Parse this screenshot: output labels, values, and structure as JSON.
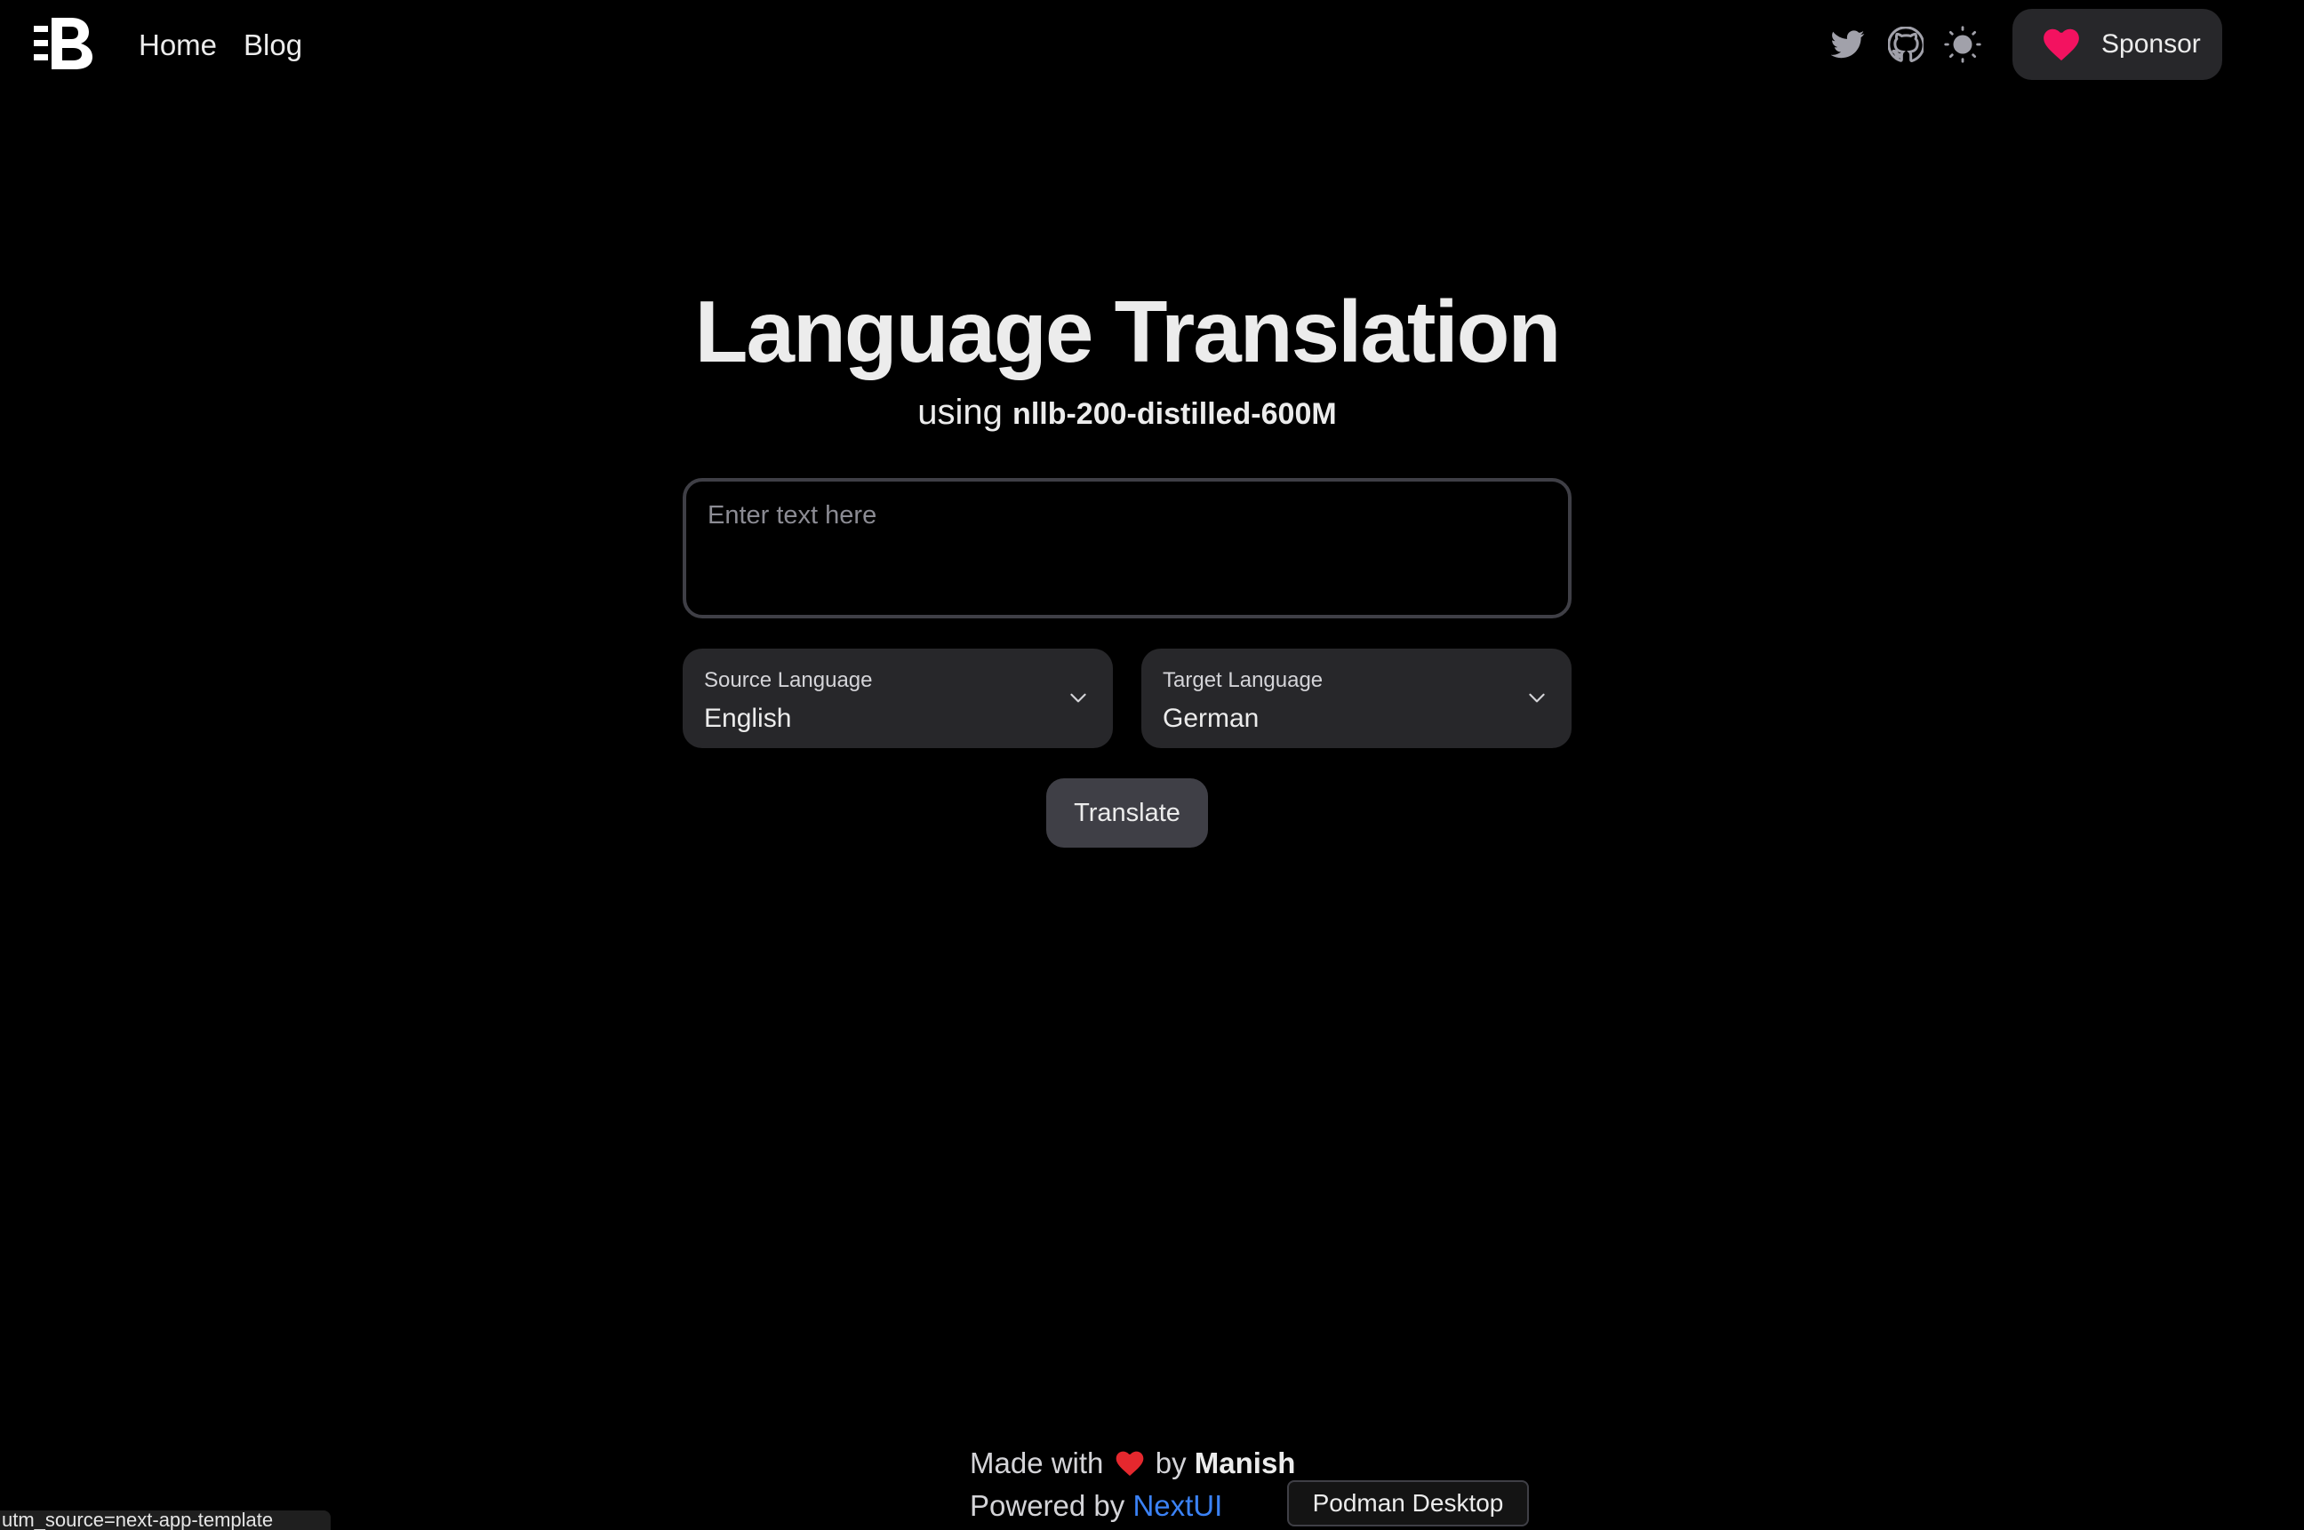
{
  "nav": {
    "home": "Home",
    "blog": "Blog",
    "sponsor": "Sponsor"
  },
  "icons": {
    "logo": "brand-logo-icon",
    "twitter": "twitter-icon",
    "github": "github-icon",
    "theme": "sun-icon",
    "heart": "heart-icon",
    "chevron": "chevron-down-icon"
  },
  "hero": {
    "title": "Language Translation",
    "subtitle_prefix": "using",
    "model": "nllb-200-distilled-600M"
  },
  "input": {
    "placeholder": "Enter text here",
    "value": ""
  },
  "source_select": {
    "label": "Source Language",
    "value": "English"
  },
  "target_select": {
    "label": "Target Language",
    "value": "German"
  },
  "actions": {
    "translate": "Translate"
  },
  "footer": {
    "made_with": "Made with",
    "by": "by",
    "author": "Manish",
    "powered_by": "Powered by",
    "library": "NextUI"
  },
  "tooltip": {
    "text": "Podman Desktop"
  },
  "statusbar": {
    "url": "utm_source=next-app-template"
  },
  "colors": {
    "background": "#000000",
    "surface": "#27272a",
    "button": "#3f3f46",
    "text": "#ececec",
    "link": "#3b82f6",
    "heart": "#f31260"
  }
}
